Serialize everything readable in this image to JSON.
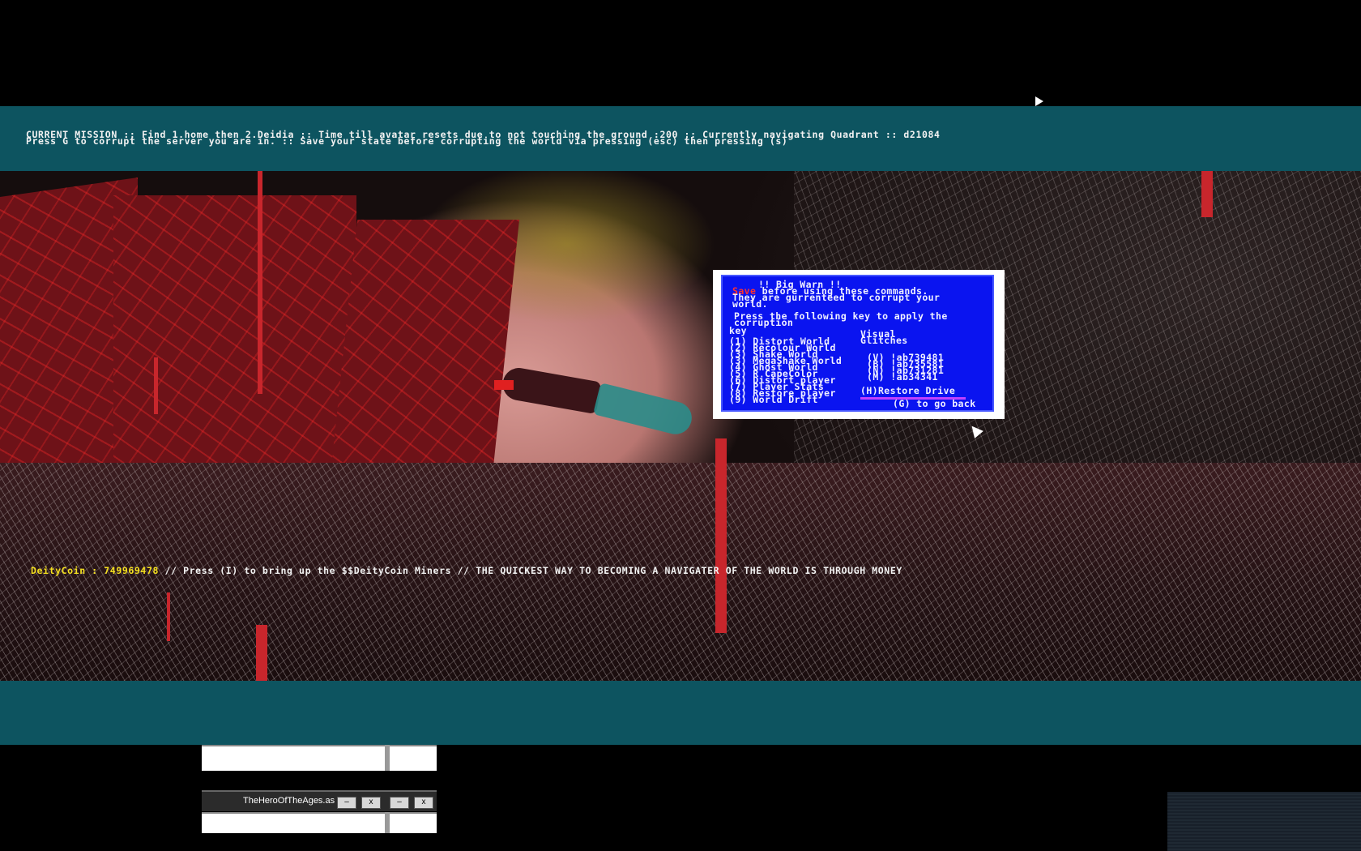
{
  "hud": {
    "mission_line1": "CURRENT MISSION :: Find 1.home then 2.Deidia :: Time till avatar resets due to not touching the ground :200 :: Currently navigating Quadrant :: d21084",
    "mission_line2": "Press G to corrupt the server you are in. :: Save your state before corrupting the world via pressing (esc) then pressing (s)",
    "coin_label": "DeityCoin : 749969478",
    "coin_rest": " // Press (I) to bring up the $$DeityCoin Miners // THE QUICKEST WAY TO BECOMING A NAVIGATER OF THE WORLD IS THROUGH MONEY"
  },
  "warn_panel": {
    "title": "!! Big Warn !!",
    "save_word": "Save",
    "line1_rest": " before using these commands.",
    "line2": "They are gurrenteed to corrupt your",
    "line3": "world.",
    "line4": "Press the following key to apply the",
    "line5": "corruption",
    "key_header": "key",
    "visual_header": "Visual",
    "glitches_header": "Glitches",
    "commands": [
      "(1) Distort World",
      "(2) Recolour World",
      "(3) Shake World",
      "(3) MegaShake World",
      "(4) Ghost World",
      "(5) R CapeColor",
      "(6) Distort player",
      "(7) Player Stats",
      "(8) Restore player",
      "(9) World Drift"
    ],
    "glitches": [
      "(V) !ab739481",
      "(B) !ab735581",
      "(N) !ab731281",
      "(M) !ab34341"
    ],
    "restore_drive": "(H)Restore Drive",
    "go_back": "(G) to go back"
  },
  "taskbar": {
    "title": "TheHeroOfTheAges.as",
    "minimize": "–",
    "close": "x"
  },
  "colors": {
    "hud_teal": "#0d5460",
    "panel_blue": "#0a14f0",
    "coin_yellow": "#f4e020"
  }
}
